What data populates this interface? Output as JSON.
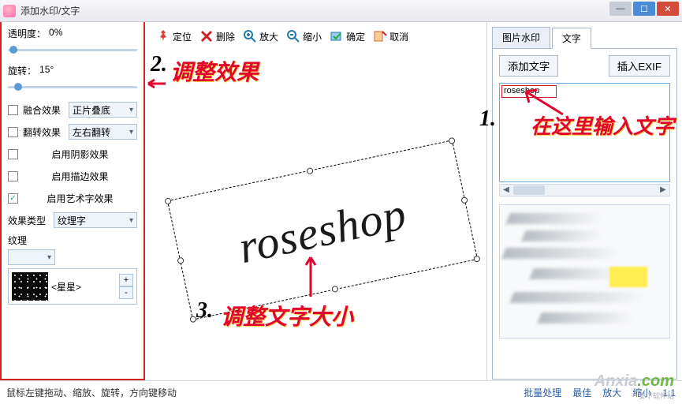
{
  "window": {
    "title": "添加水印/文字"
  },
  "left": {
    "opacity_label": "透明度：",
    "opacity_value": "0%",
    "rotate_label": "旋转：",
    "rotate_value": "15°",
    "blend_label": "融合效果",
    "blend_mode": "正片叠底",
    "flip_label": "翻转效果",
    "flip_mode": "左右翻转",
    "shadow_label": "启用阴影效果",
    "stroke_label": "启用描边效果",
    "art_label": "启用艺术字效果",
    "effect_type_label": "效果类型",
    "effect_type_value": "纹理字",
    "texture_label": "纹理",
    "texture_name": "<星星>"
  },
  "toolbar": {
    "locate": "定位",
    "delete": "删除",
    "zoom_in": "放大",
    "zoom_out": "缩小",
    "confirm": "确定",
    "cancel": "取消"
  },
  "canvas": {
    "watermark_text": "roseshop"
  },
  "annotations": {
    "n1": "1.",
    "t1": "在这里输入文字",
    "n2": "2.",
    "t2": "调整效果",
    "n3": "3.",
    "t3": "调整文字大小"
  },
  "right": {
    "tab_image": "图片水印",
    "tab_text": "文字",
    "btn_add_text": "添加文字",
    "btn_insert_exif": "插入EXIF",
    "input_value": "roseshop"
  },
  "status": {
    "hint": "鼠标左键拖动、缩放、旋转，方向键移动",
    "batch": "批量处理",
    "best": "最佳",
    "zoom_in": "放大",
    "zoom_out": "缩小",
    "ratio": "1:1"
  },
  "brand": {
    "name": "Anxia",
    "tld": ".com",
    "cn": "安下软件站"
  }
}
